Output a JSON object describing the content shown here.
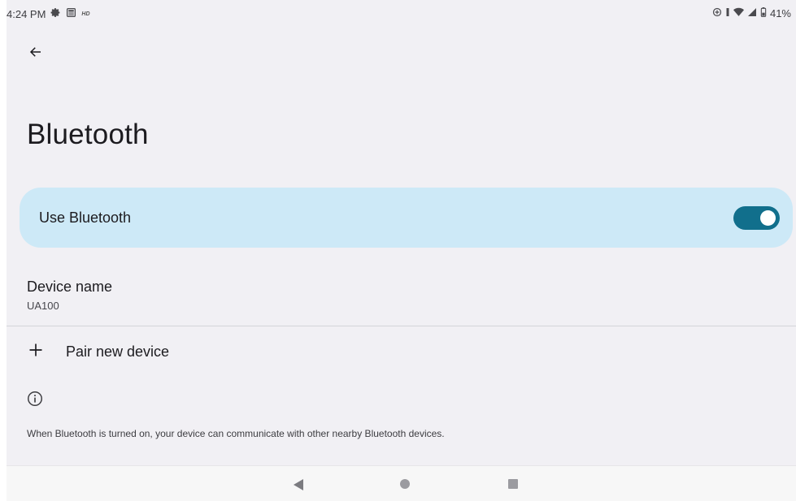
{
  "status_bar": {
    "time": "4:24 PM",
    "hd_badge": "HD",
    "battery": "41%",
    "icons": [
      "settings-gear-icon",
      "notification-news-icon",
      "data-saver-icon",
      "vibrate-icon",
      "wifi-icon",
      "cellular-signal-icon",
      "battery-icon"
    ]
  },
  "header": {
    "back_icon": "back-arrow-icon",
    "title": "Bluetooth"
  },
  "main_toggle": {
    "label": "Use Bluetooth",
    "enabled": true,
    "colors": {
      "card": "#cde9f7",
      "track": "#116f8c",
      "thumb": "#ffffff"
    }
  },
  "device_name": {
    "title": "Device name",
    "value": "UA100"
  },
  "pair": {
    "icon": "plus-icon",
    "label": "Pair new device"
  },
  "info": {
    "icon": "info-icon",
    "text": "When Bluetooth is turned on, your device can communicate with other nearby Bluetooth devices."
  },
  "nav_bar": {
    "buttons": [
      "back-triangle-icon",
      "home-circle-icon",
      "recents-square-icon"
    ]
  }
}
